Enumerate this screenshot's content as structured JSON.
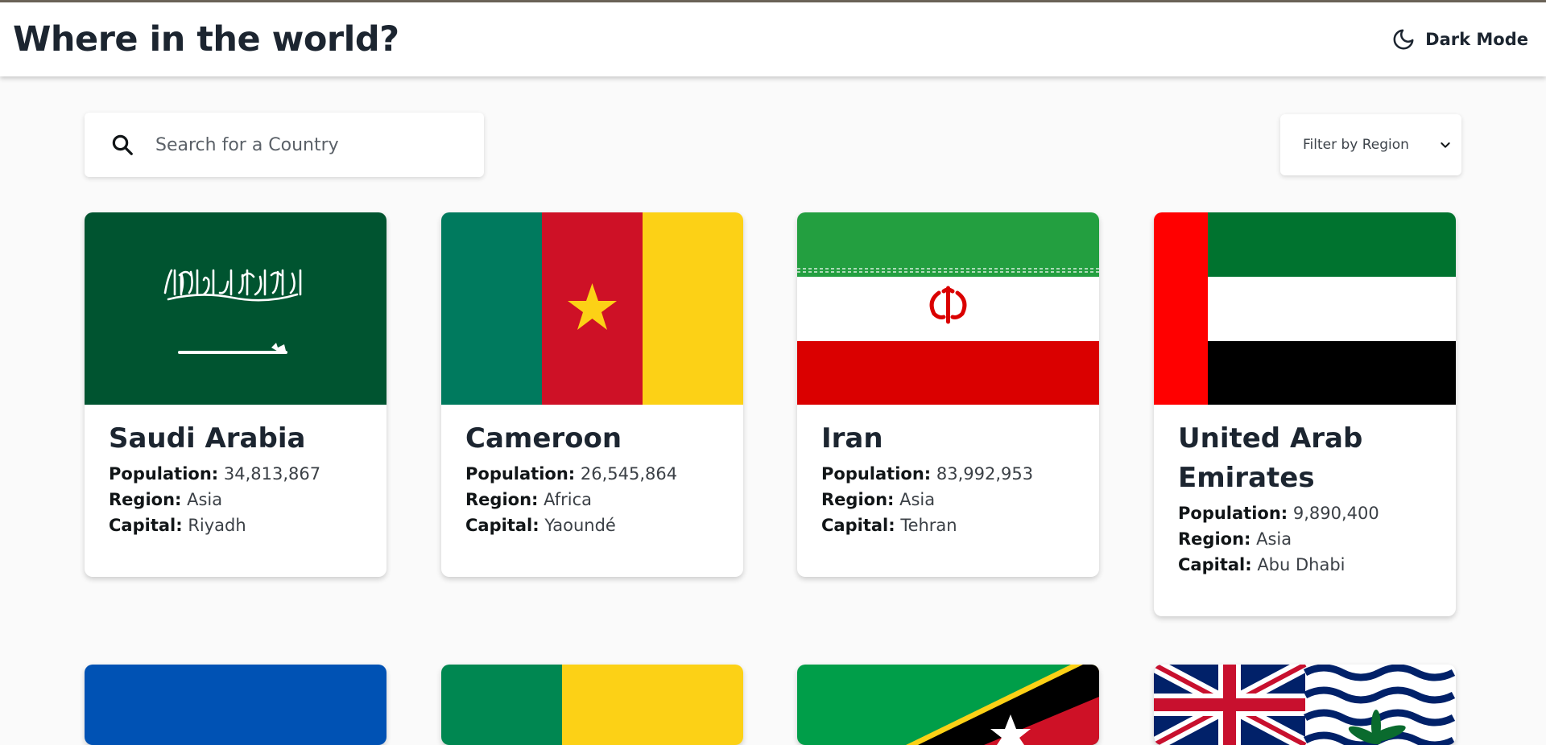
{
  "header": {
    "title": "Where in the world?",
    "theme_toggle_label": "Dark Mode",
    "theme_icon": "moon-icon"
  },
  "search": {
    "placeholder": "Search for a Country",
    "value": "",
    "icon": "search-icon"
  },
  "filter": {
    "label": "Filter by Region",
    "icon": "chevron-down-icon"
  },
  "field_labels": {
    "population": "Population:",
    "region": "Region:",
    "capital": "Capital:"
  },
  "countries": [
    {
      "name": "Saudi Arabia",
      "population": "34,813,867",
      "region": "Asia",
      "capital": "Riyadh"
    },
    {
      "name": "Cameroon",
      "population": "26,545,864",
      "region": "Africa",
      "capital": "Yaoundé"
    },
    {
      "name": "Iran",
      "population": "83,992,953",
      "region": "Asia",
      "capital": "Tehran"
    },
    {
      "name": "United Arab Emirates",
      "population": "9,890,400",
      "region": "Asia",
      "capital": "Abu Dhabi"
    }
  ],
  "colors": {
    "background": "#fafafa",
    "card": "#ffffff",
    "text": "#111517"
  }
}
